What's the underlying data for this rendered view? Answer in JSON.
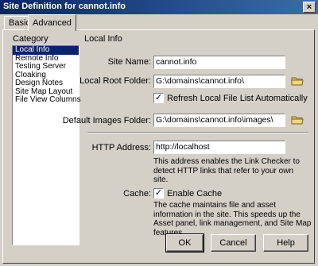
{
  "window": {
    "title": "Site Definition for cannot.info",
    "close_glyph": "×"
  },
  "tabs": [
    {
      "label": "Basic"
    },
    {
      "label": "Advanced"
    }
  ],
  "category": {
    "heading": "Category",
    "items": [
      {
        "label": "Local Info"
      },
      {
        "label": "Remote Info"
      },
      {
        "label": "Testing Server"
      },
      {
        "label": "Cloaking"
      },
      {
        "label": "Design Notes"
      },
      {
        "label": "Site Map Layout"
      },
      {
        "label": "File View Columns"
      }
    ]
  },
  "section": {
    "title": "Local Info"
  },
  "fields": {
    "site_name": {
      "label": "Site Name:",
      "value": "cannot.info"
    },
    "local_root": {
      "label": "Local Root Folder:",
      "value": "G:\\domains\\cannot.info\\"
    },
    "refresh": {
      "label": "Refresh Local File List Automatically",
      "checked": true
    },
    "default_images": {
      "label": "Default Images Folder:",
      "value": "G:\\domains\\cannot.info\\images\\"
    },
    "http_address": {
      "label": "HTTP Address:",
      "value": "http://localhost"
    },
    "http_desc_1": "This address enables the Link Checker to",
    "http_desc_2": "detect HTTP links that refer to your own",
    "http_desc_3": "site.",
    "cache": {
      "label": "Cache:",
      "checkbox_label": "Enable Cache",
      "checked": true
    },
    "cache_desc_1": "The cache maintains file and asset",
    "cache_desc_2": "information in the site.  This speeds up the",
    "cache_desc_3": "Asset panel, link management, and Site Map",
    "cache_desc_4": "features."
  },
  "buttons": {
    "ok": "OK",
    "cancel": "Cancel",
    "help": "Help"
  },
  "colors": {
    "titlebar": "#0a246a",
    "selection": "#0a246a",
    "folder": "#e8c050"
  }
}
